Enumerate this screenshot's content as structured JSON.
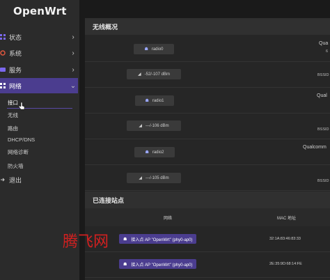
{
  "brand": "OpenWrt",
  "sidebar": {
    "items": [
      {
        "label": "状态",
        "icon": "status-grid-icon",
        "color": "#7b68ee"
      },
      {
        "label": "系统",
        "icon": "system-gear-icon",
        "color": "#e0573e"
      },
      {
        "label": "服务",
        "icon": "services-icon",
        "color": "#7b68ee"
      },
      {
        "label": "网络",
        "icon": "network-icon",
        "color": "#ffffff"
      }
    ],
    "network_sub": [
      "接口",
      "无线",
      "路由",
      "DHCP/DNS",
      "网络诊断",
      "防火墙"
    ],
    "logout": "退出"
  },
  "wireless_overview": {
    "title": "无线概况",
    "radios": [
      {
        "radio": "radio0",
        "right_text": "Qua",
        "right_sub": "6",
        "signal": "-52/-107 dBm",
        "signal_right": "BSSID"
      },
      {
        "radio": "radio1",
        "right_text": "Qual",
        "right_sub": "",
        "signal": "---/-106 dBm",
        "signal_right": "BSSID"
      },
      {
        "radio": "radio2",
        "right_text": "Qualcomm",
        "right_sub": "",
        "signal": "---/-105 dBm",
        "signal_right": "BSSID"
      }
    ]
  },
  "associated": {
    "title": "已连接站点",
    "col_network": "网络",
    "col_mac": "MAC 地址",
    "rows": [
      {
        "network": "接入点 AP \"OpenWrt\" (phy0-ap0)",
        "mac": "32:1A:83:46:83:33"
      },
      {
        "network": "接入点 AP \"OpenWrt\" (phy0-ap0)",
        "mac": "2E:35:9D:68:14:FE"
      }
    ]
  },
  "watermark": "腾飞网",
  "colors": {
    "accent": "#4b3d8f",
    "sidebar_bg": "#2b2b2b",
    "main_bg": "#262626"
  }
}
